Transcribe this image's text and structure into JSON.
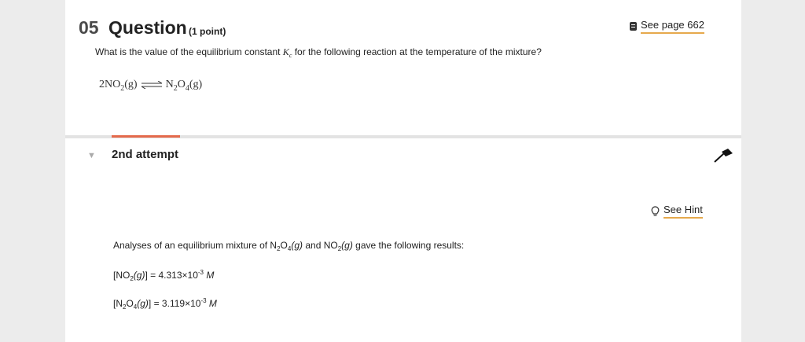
{
  "question": {
    "number": "05",
    "title": "Question",
    "points": "(1 point)",
    "see_page_label": "See page 662",
    "prompt_before": "What is the value of the equilibrium constant ",
    "kc_symbol": "K",
    "kc_sub": "c",
    "prompt_after": " for the following reaction at the temperature of the mixture?",
    "reaction": {
      "left_coef": "2NO",
      "left_sub": "2",
      "left_state": "(g)",
      "right_species_n": "N",
      "right_sub_n": "2",
      "right_species_o": "O",
      "right_sub_o": "4",
      "right_state": "(g)"
    }
  },
  "attempt": {
    "label": "2nd attempt",
    "see_hint_label": "See Hint",
    "analyses_text": {
      "a": "Analyses of an equilibrium mixture of N",
      "b": "2",
      "c": "O",
      "d": "4",
      "e": "(g)",
      "f": " and NO",
      "g": "2",
      "h": "(g)",
      "i": " gave the following results:"
    },
    "no2": {
      "open": "[NO",
      "sub": "2",
      "state": "(g)",
      "close": "] = 4.313×10",
      "exp": "-3",
      "unit": " M"
    },
    "n2o4": {
      "open": "[N",
      "sub1": "2",
      "mid": "O",
      "sub2": "4",
      "state": "(g)",
      "close": "] = 3.119×10",
      "exp": "-3",
      "unit": " M"
    }
  },
  "icons": {
    "book": "book-icon",
    "chevron": "chevron-down-icon",
    "pin": "pin-icon",
    "bulb": "lightbulb-icon"
  },
  "colors": {
    "accent_bar": "#e46a4c",
    "link_underline": "#e6a94c",
    "background": "#ececec"
  }
}
